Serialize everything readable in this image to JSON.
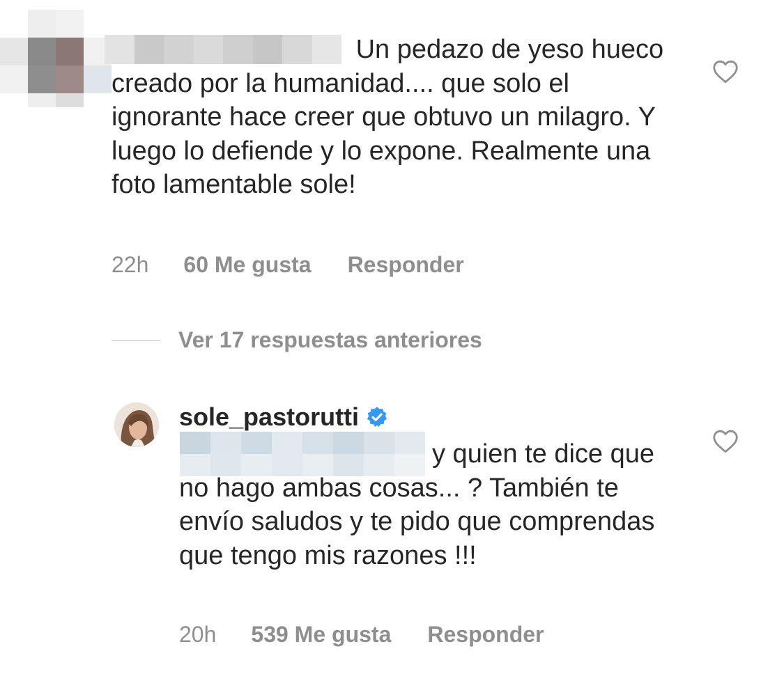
{
  "comment": {
    "text_first_line": "Un pedazo de yeso",
    "text_rest": "hueco creado por la humanidad.... que solo el ignorante hace creer que obtuvo un milagro. Y luego lo defiende y lo expone. Realmente una foto lamentable sole!",
    "time": "22h",
    "likes": "60 Me gusta",
    "reply_label": "Responder",
    "like_icon": "heart-outline-icon"
  },
  "view_replies": {
    "label": "Ver 17 respuestas anteriores"
  },
  "reply": {
    "username": "sole_pastorutti",
    "verified_icon": "verified-badge-icon",
    "text_first_line": "y quien te dice",
    "text_rest": "que no hago ambas cosas... ? También te envío saludos y te pido que comprendas que tengo mis razones !!!",
    "time": "20h",
    "likes": "539 Me gusta",
    "reply_label": "Responder",
    "like_icon": "heart-outline-icon"
  },
  "colors": {
    "text": "#262626",
    "secondary": "#8e8e8e",
    "divider": "#dbdbdb",
    "verified": "#3897f0"
  }
}
